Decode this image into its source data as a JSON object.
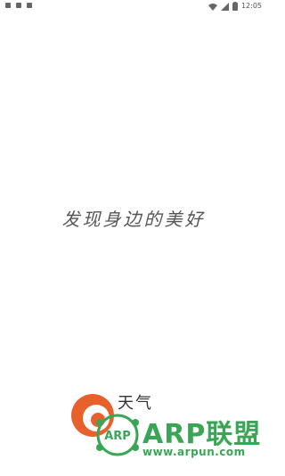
{
  "status_bar": {
    "time": "12:05",
    "icons": [
      "notification-icon",
      "notification-icon",
      "notification-icon",
      "wifi-icon",
      "signal-icon",
      "battery-icon"
    ]
  },
  "splash": {
    "slogan": "发现身边的美好",
    "brand_name": "天气"
  },
  "watermark": {
    "badge": "ARP",
    "title": "ARP联盟",
    "url": "www.arpun.com",
    "color": "#3aa655"
  },
  "colors": {
    "background": "#ffffff",
    "slogan": "#555555",
    "logo_orange": "#e8612c"
  }
}
